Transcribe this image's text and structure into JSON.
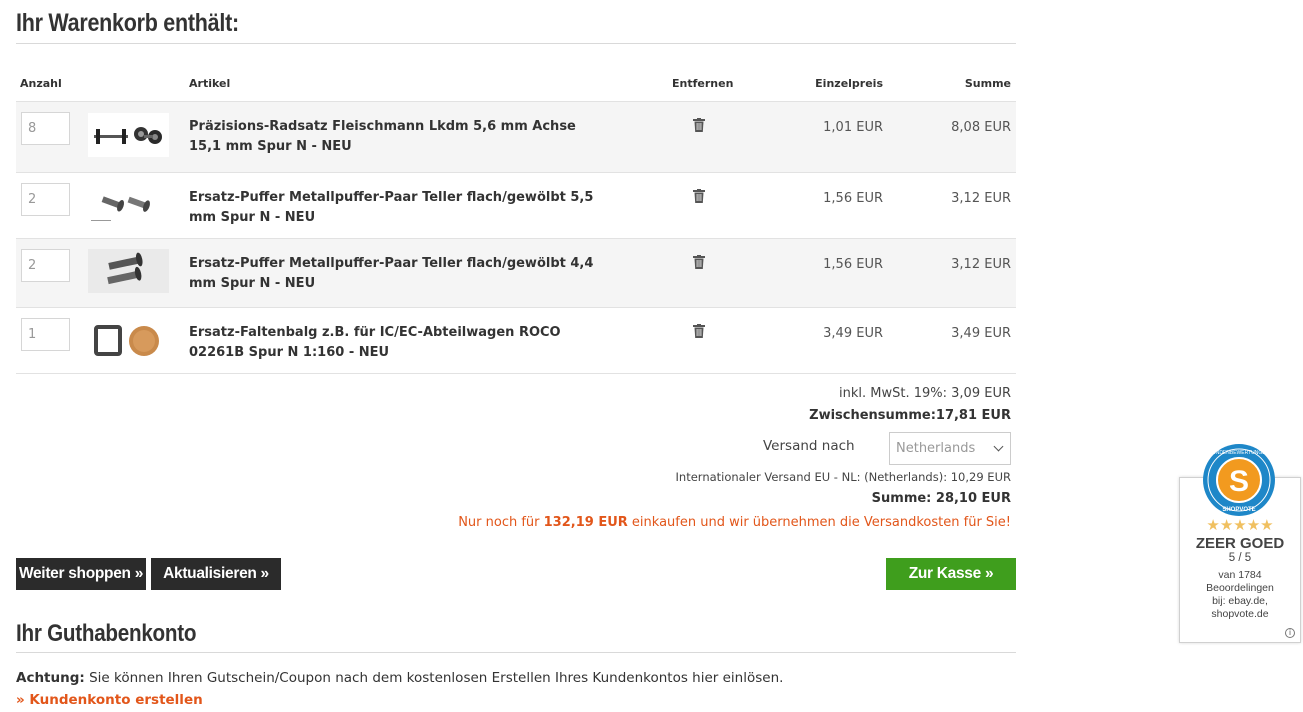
{
  "cart": {
    "title": "Ihr Warenkorb enthält:",
    "columns": {
      "qty": "Anzahl",
      "article": "Artikel",
      "remove": "Entfernen",
      "unit_price": "Einzelpreis",
      "total": "Summe"
    },
    "items": [
      {
        "qty": "8",
        "title": "Präzisions-Radsatz Fleischmann Lkdm 5,6 mm Achse 15,1 mm Spur N - NEU",
        "unit_price": "1,01 EUR",
        "total": "8,08 EUR"
      },
      {
        "qty": "2",
        "title": "Ersatz-Puffer Metallpuffer-Paar Teller flach/gewölbt 5,5 mm Spur N - NEU",
        "unit_price": "1,56 EUR",
        "total": "3,12 EUR"
      },
      {
        "qty": "2",
        "title": "Ersatz-Puffer Metallpuffer-Paar Teller flach/gewölbt 4,4 mm Spur N - NEU",
        "unit_price": "1,56 EUR",
        "total": "3,12 EUR"
      },
      {
        "qty": "1",
        "title": "Ersatz-Faltenbalg z.B. für IC/EC-Abteilwagen ROCO 02261B Spur N 1:160 - NEU",
        "unit_price": "3,49 EUR",
        "total": "3,49 EUR"
      }
    ],
    "remove_icon": "trash-icon",
    "vat_line": "inkl. MwSt. 19%: 3,09 EUR",
    "subtotal": "Zwischensumme:17,81 EUR",
    "shipping_label": "Versand nach",
    "shipping_country": "Netherlands",
    "shipping_line": "Internationaler Versand EU - NL: (Netherlands): 10,29 EUR",
    "total": "Summe: 28,10 EUR",
    "free_shipping": {
      "prefix": "Nur noch für ",
      "amount": "132,19 EUR",
      "suffix": " einkaufen und wir übernehmen die Versandkosten für Sie!"
    },
    "buttons": {
      "continue": "Weiter shoppen »",
      "update": "Aktualisieren »",
      "checkout": "Zur Kasse »"
    }
  },
  "credit": {
    "title": "Ihr Guthabenkonto",
    "note_bold": "Achtung:",
    "note_text": " Sie können Ihren Gutschein/Coupon nach dem kostenlosen Erstellen Ihres Kundenkontos hier einlösen.",
    "link": "» Kundenkonto erstellen"
  },
  "badge": {
    "seal_letter": "S",
    "seal_top_text": "KUNDENBEWERTUNGEN",
    "seal_bottom_text": "SHOPVOTE",
    "stars": "★★★★★",
    "rating_label": "ZEER GOED",
    "score": "5 / 5",
    "count": "van 1784",
    "reviews": "Beoordelingen",
    "source1": "bij: ebay.de,",
    "source2": "shopvote.de",
    "info": "i"
  },
  "colors": {
    "orange": "#e2561a",
    "green": "#3f9e1d",
    "dark": "#2b2b2b",
    "badge_blue": "#1e87c8",
    "badge_orange": "#f29a1f",
    "star": "#f0c060"
  }
}
